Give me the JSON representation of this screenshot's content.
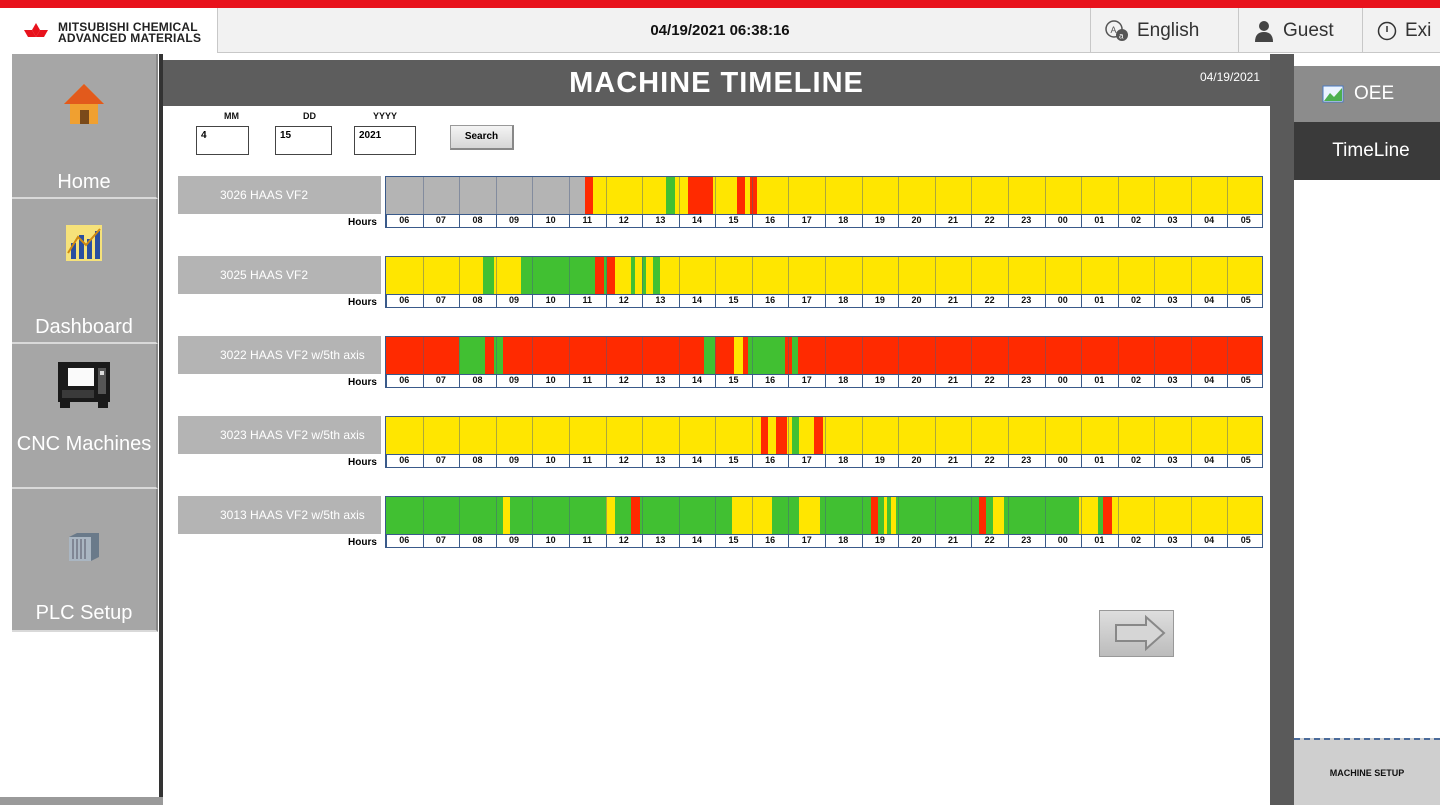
{
  "header": {
    "logo_line1": "MITSUBISHI CHEMICAL",
    "logo_line2": "ADVANCED MATERIALS",
    "datetime": "04/19/2021   06:38:16",
    "language": "English",
    "user": "Guest",
    "exit": "Exi"
  },
  "nav": {
    "items": [
      {
        "label": "Home",
        "icon": "home-icon"
      },
      {
        "label": "Dashboard",
        "icon": "chart-icon"
      },
      {
        "label": "CNC Machines",
        "icon": "cnc-machine-icon"
      },
      {
        "label": "PLC Setup",
        "icon": "plc-icon"
      }
    ]
  },
  "main": {
    "title": "MACHINE TIMELINE",
    "title_date": "04/19/2021",
    "filters": {
      "mm_label": "MM",
      "dd_label": "DD",
      "yyyy_label": "YYYY",
      "mm_value": "4",
      "dd_value": "15",
      "yyyy_value": "2021",
      "search_label": "Search"
    },
    "hours_label": "Hours",
    "hours": [
      "06",
      "07",
      "08",
      "09",
      "10",
      "11",
      "12",
      "13",
      "14",
      "15",
      "16",
      "17",
      "18",
      "19",
      "20",
      "21",
      "22",
      "23",
      "00",
      "01",
      "02",
      "03",
      "04",
      "05"
    ],
    "colors": {
      "idle": "#ffe600",
      "running": "#41c032",
      "down": "#ff2a00",
      "offline": "#b4b4b4"
    },
    "machines": [
      {
        "name": "3026 HAAS VF2",
        "base": "idle",
        "segments": [
          {
            "start": 0,
            "end": 5.45,
            "state": "offline"
          },
          {
            "start": 5.45,
            "end": 5.65,
            "state": "down"
          },
          {
            "start": 7.65,
            "end": 7.9,
            "state": "running"
          },
          {
            "start": 8.25,
            "end": 8.95,
            "state": "down"
          },
          {
            "start": 9.6,
            "end": 9.8,
            "state": "down"
          },
          {
            "start": 9.95,
            "end": 10.15,
            "state": "down"
          }
        ]
      },
      {
        "name": "3025 HAAS VF2",
        "base": "idle",
        "segments": [
          {
            "start": 2.65,
            "end": 2.95,
            "state": "running"
          },
          {
            "start": 3.7,
            "end": 5.7,
            "state": "running"
          },
          {
            "start": 5.7,
            "end": 5.95,
            "state": "down"
          },
          {
            "start": 5.95,
            "end": 6.05,
            "state": "running"
          },
          {
            "start": 6.05,
            "end": 6.25,
            "state": "down"
          },
          {
            "start": 6.7,
            "end": 6.8,
            "state": "running"
          },
          {
            "start": 7.0,
            "end": 7.1,
            "state": "running"
          },
          {
            "start": 7.3,
            "end": 7.5,
            "state": "running"
          }
        ]
      },
      {
        "name": "3022 HAAS VF2 w/5th axis",
        "base": "down",
        "segments": [
          {
            "start": 2.0,
            "end": 2.7,
            "state": "running"
          },
          {
            "start": 2.95,
            "end": 3.2,
            "state": "running"
          },
          {
            "start": 8.7,
            "end": 9.0,
            "state": "running"
          },
          {
            "start": 9.5,
            "end": 9.75,
            "state": "idle"
          },
          {
            "start": 9.9,
            "end": 10.9,
            "state": "running"
          },
          {
            "start": 11.1,
            "end": 11.25,
            "state": "running"
          }
        ]
      },
      {
        "name": "3023 HAAS VF2 w/5th axis",
        "base": "idle",
        "segments": [
          {
            "start": 10.25,
            "end": 10.45,
            "state": "down"
          },
          {
            "start": 10.65,
            "end": 10.95,
            "state": "down"
          },
          {
            "start": 11.1,
            "end": 11.3,
            "state": "running"
          },
          {
            "start": 11.7,
            "end": 11.95,
            "state": "down"
          }
        ]
      },
      {
        "name": "3013 HAAS VF2 w/5th axis",
        "base": "running",
        "segments": [
          {
            "start": 3.2,
            "end": 3.4,
            "state": "idle"
          },
          {
            "start": 6.0,
            "end": 6.25,
            "state": "idle"
          },
          {
            "start": 6.7,
            "end": 6.95,
            "state": "down"
          },
          {
            "start": 9.45,
            "end": 10.55,
            "state": "idle"
          },
          {
            "start": 11.3,
            "end": 11.85,
            "state": "idle"
          },
          {
            "start": 13.25,
            "end": 13.45,
            "state": "down"
          },
          {
            "start": 13.6,
            "end": 13.7,
            "state": "idle"
          },
          {
            "start": 13.8,
            "end": 13.95,
            "state": "idle"
          },
          {
            "start": 16.2,
            "end": 16.4,
            "state": "down"
          },
          {
            "start": 16.6,
            "end": 16.9,
            "state": "idle"
          },
          {
            "start": 18.95,
            "end": 19.45,
            "state": "idle"
          },
          {
            "start": 19.6,
            "end": 19.85,
            "state": "down"
          },
          {
            "start": 19.85,
            "end": 24,
            "state": "idle"
          }
        ]
      }
    ]
  },
  "right": {
    "oee_label": "OEE",
    "timeline_label": "TimeLine",
    "machine_setup_label": "MACHINE SETUP"
  }
}
